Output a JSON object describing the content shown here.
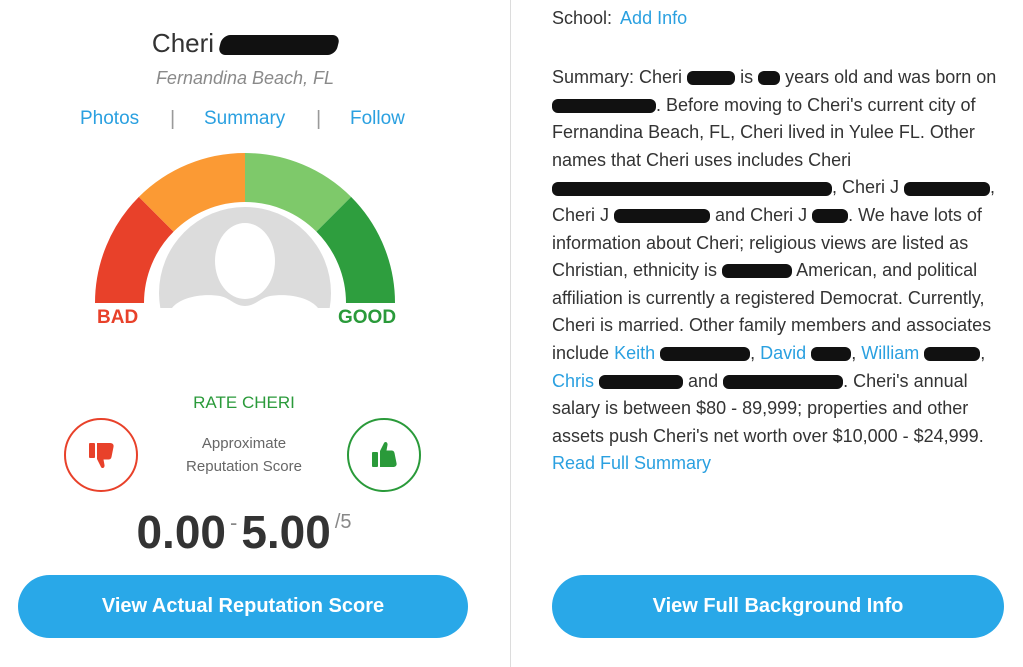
{
  "profile": {
    "first_name": "Cheri",
    "location": "Fernandina Beach, FL"
  },
  "links": {
    "photos": "Photos",
    "summary": "Summary",
    "follow": "Follow",
    "separator": "|"
  },
  "gauge": {
    "bad_label": "BAD",
    "good_label": "GOOD",
    "colors": {
      "red": "#e8412a",
      "orange": "#fb9a34",
      "light_green": "#7ec96a",
      "green": "#2e9e3e"
    }
  },
  "rating": {
    "title": "RATE CHERI",
    "approx_line1": "Approximate",
    "approx_line2": "Reputation Score",
    "score_low": "0.00",
    "score_dash": "-",
    "score_high": "5.00",
    "score_out_of": "/5"
  },
  "buttons": {
    "view_reputation": "View Actual Reputation Score",
    "view_background": "View Full Background Info"
  },
  "school": {
    "label": "School:",
    "link": "Add Info"
  },
  "summary": {
    "label": "Summary:",
    "p1": "Cheri",
    "p2": "is",
    "p3": "years old and was born on",
    "p4": ". Before moving to Cheri's current city of Fernandina Beach, FL, Cheri lived in Yulee FL. Other names that Cheri uses includes Cheri",
    "p5": ", Cheri J",
    "p6": ", Cheri J",
    "p7": "and Cheri J",
    "p8": ". We have lots of information about Cheri; religious views are listed as Christian, ethnicity is",
    "p9": "American, and political affiliation is currently a registered Democrat. Currently, Cheri is married. Other family members and associates include",
    "rel1": "Keith",
    "comma": ",",
    "rel2": "David",
    "rel3": "William",
    "rel4": "Chris",
    "and_text": "and",
    "p10": ". Cheri's annual salary is between $80 - 89,999; properties and other assets push Cheri's net worth over $10,000 - $24,999.",
    "read_more": "Read Full Summary"
  }
}
